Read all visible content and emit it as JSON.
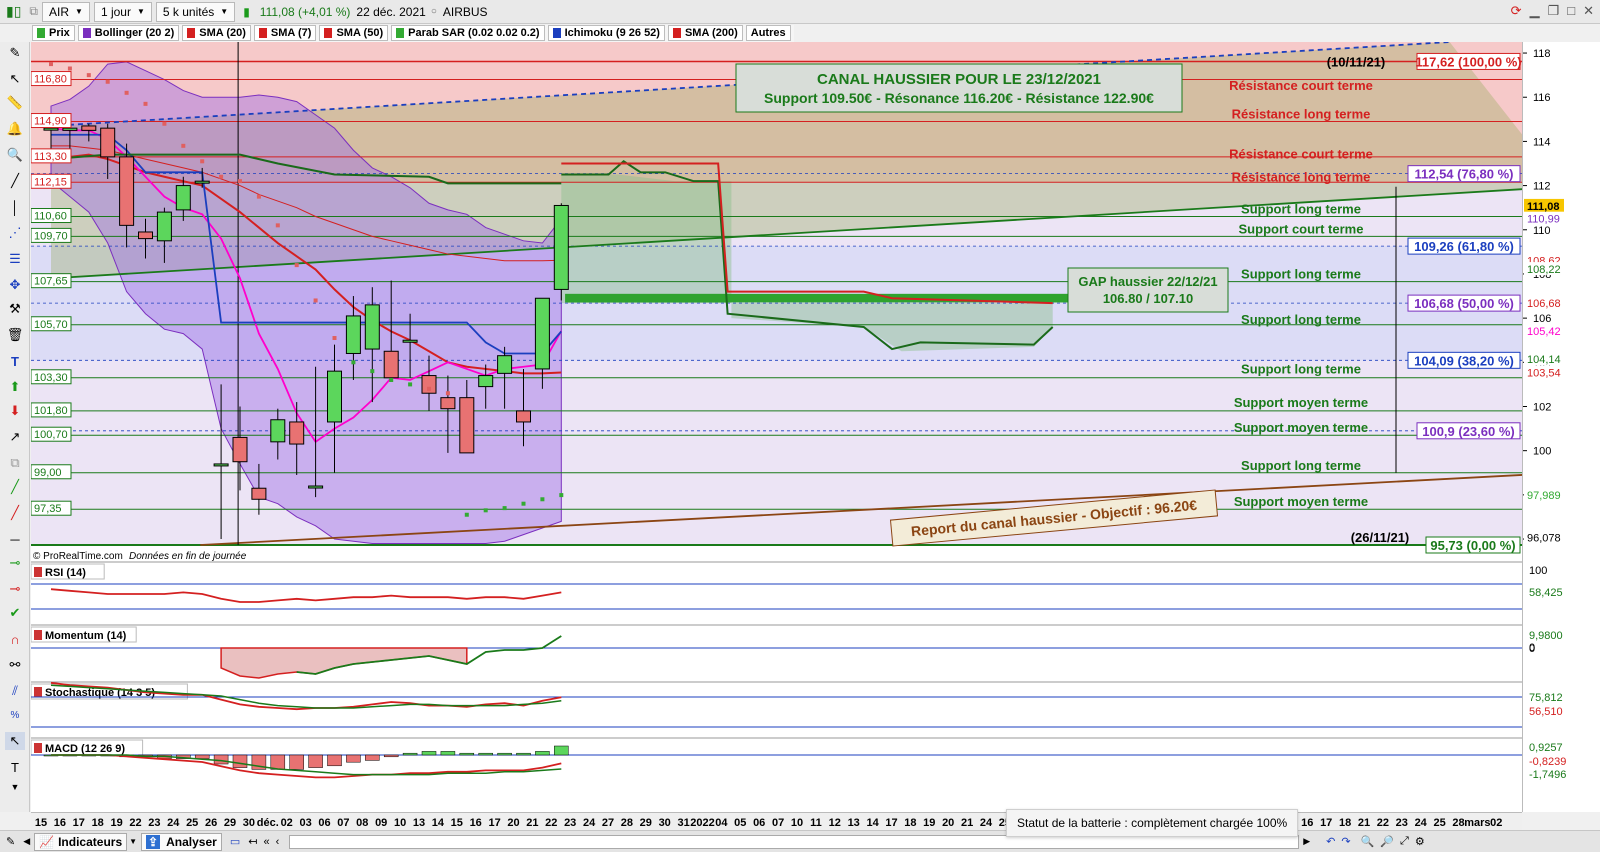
{
  "toolbar": {
    "ticker": "AIR",
    "period": "1 jour",
    "units": "5 k unités",
    "price": "111,08 (+4,01 %)",
    "date": "22 déc. 2021",
    "name": "AIRBUS"
  },
  "legend": [
    {
      "label": "Prix",
      "color": "#33aa33"
    },
    {
      "label": "Bollinger (20 2)",
      "color": "#7b2fbf"
    },
    {
      "label": "SMA (20)",
      "color": "#d42020"
    },
    {
      "label": "SMA (7)",
      "color": "#d42020"
    },
    {
      "label": "SMA (50)",
      "color": "#d42020"
    },
    {
      "label": "Parab SAR (0.02 0.02 0.2)",
      "color": "#33aa33"
    },
    {
      "label": "Ichimoku (9 26 52)",
      "color": "#1b3fbf"
    },
    {
      "label": "SMA (200)",
      "color": "#d42020"
    },
    {
      "label": "Autres",
      "color": ""
    }
  ],
  "annotations": {
    "canal_line1": "CANAL HAUSSIER POUR LE 23/12/2021",
    "canal_line2": "Support 109.50€ - Résonance 116.20€ - Résistance 122.90€",
    "gap_line1": "GAP haussier 22/12/21",
    "gap_line2": "106.80 / 107.10",
    "report": "Report du canal haussier - Objectif : 96.20€",
    "date_top": "(10/11/21)",
    "date_bottom": "(26/11/21)",
    "copyright": "© ProRealTime.com",
    "copyright_note": "Données en fin de journée"
  },
  "levels_left": [
    {
      "label": "116,80",
      "color": "#d42020"
    },
    {
      "label": "114,90",
      "color": "#d42020"
    },
    {
      "label": "113,30",
      "color": "#d42020"
    },
    {
      "label": "112,15",
      "color": "#d42020"
    },
    {
      "label": "110,60",
      "color": "#1a7a1a"
    },
    {
      "label": "109,70",
      "color": "#1a7a1a"
    },
    {
      "label": "107,65",
      "color": "#1a7a1a"
    },
    {
      "label": "105,70",
      "color": "#1a7a1a"
    },
    {
      "label": "103,30",
      "color": "#1a7a1a"
    },
    {
      "label": "101,80",
      "color": "#1a7a1a"
    },
    {
      "label": "100,70",
      "color": "#1a7a1a"
    },
    {
      "label": "99,00",
      "color": "#1a7a1a"
    },
    {
      "label": "97,35",
      "color": "#1a7a1a"
    }
  ],
  "level_texts": [
    {
      "label": "Résistance court terme",
      "color": "#d42020"
    },
    {
      "label": "Résistance long terme",
      "color": "#d42020"
    },
    {
      "label": "Résistance court terme",
      "color": "#d42020"
    },
    {
      "label": "Résistance long terme",
      "color": "#d42020"
    },
    {
      "label": "Support  long terme",
      "color": "#1a7a1a"
    },
    {
      "label": "Support court terme",
      "color": "#1a7a1a"
    },
    {
      "label": "Support  long terme",
      "color": "#1a7a1a"
    },
    {
      "label": "Support  long terme",
      "color": "#1a7a1a"
    },
    {
      "label": "Support  long terme",
      "color": "#1a7a1a"
    },
    {
      "label": "Support moyen terme",
      "color": "#1a7a1a"
    },
    {
      "label": "Support moyen terme",
      "color": "#1a7a1a"
    },
    {
      "label": "Support  long terme",
      "color": "#1a7a1a"
    },
    {
      "label": "Support moyen terme",
      "color": "#1a7a1a"
    }
  ],
  "fibo": [
    {
      "label": "117,62 (100,00 %)",
      "color": "#d42020"
    },
    {
      "label": "112,54 (76,80 %)",
      "color": "#7b2fbf"
    },
    {
      "label": "109,26 (61,80 %)",
      "color": "#1b3fbf"
    },
    {
      "label": "106,68 (50,00 %)",
      "color": "#7b2fbf"
    },
    {
      "label": "104,09 (38,20 %)",
      "color": "#1b3fbf"
    },
    {
      "label": "100,9 (23,60 %)",
      "color": "#7b2fbf"
    },
    {
      "label": "95,73 (0,00 %)",
      "color": "#1a7a1a"
    }
  ],
  "price_axis": [
    "118",
    "116",
    "114",
    "112",
    "110",
    "108",
    "106",
    "104",
    "102",
    "100",
    "98",
    "96"
  ],
  "right_tags": [
    {
      "label": "111,08",
      "color": "#000000",
      "bg": "#f7c600"
    },
    {
      "label": "110,99",
      "color": "#7b2fbf",
      "bg": "#ffffff"
    },
    {
      "label": "108,62",
      "color": "#d42020",
      "bg": "#ffffff"
    },
    {
      "label": "108,22",
      "color": "#1a7a1a",
      "bg": "#ffffff"
    },
    {
      "label": "106,68",
      "color": "#d42020",
      "bg": "#ffffff"
    },
    {
      "label": "105,42",
      "color": "#ff00cc",
      "bg": "#ffffff"
    },
    {
      "label": "104,14",
      "color": "#1a7a1a",
      "bg": "#ffffff"
    },
    {
      "label": "103,54",
      "color": "#d42020",
      "bg": "#ffffff"
    },
    {
      "label": "97,989",
      "color": "#33aa33",
      "bg": "#ffffff"
    },
    {
      "label": "96,078",
      "color": "#000000",
      "bg": "#ffffff"
    }
  ],
  "indicators": [
    {
      "label": "RSI (14)",
      "axis": [
        "100",
        "58,425",
        "0"
      ]
    },
    {
      "label": "Momentum (14)",
      "axis": [
        "9,9800",
        "0"
      ]
    },
    {
      "label": "Stochastique (14 3 5)",
      "axis": [
        "75,812",
        "56,510"
      ]
    },
    {
      "label": "MACD (12 26 9)",
      "axis": [
        "0,9257",
        "-0,8239",
        "-1,7496"
      ]
    }
  ],
  "dates": [
    "15",
    "16",
    "17",
    "18",
    "19",
    "22",
    "23",
    "24",
    "25",
    "26",
    "29",
    "30",
    "déc.",
    "02",
    "03",
    "06",
    "07",
    "08",
    "09",
    "10",
    "13",
    "14",
    "15",
    "16",
    "17",
    "20",
    "21",
    "22",
    "23",
    "24",
    "27",
    "28",
    "29",
    "30",
    "31",
    "2022",
    "04",
    "05",
    "06",
    "07",
    "10",
    "11",
    "12",
    "13",
    "14",
    "17",
    "18",
    "19",
    "20",
    "21",
    "24",
    "25",
    "26",
    "27",
    "28",
    "31",
    "févr.",
    "02",
    "03",
    "04",
    "07",
    "08",
    "09",
    "10",
    "11",
    "14",
    "15",
    "16",
    "17",
    "18",
    "21",
    "22",
    "23",
    "24",
    "25",
    "28",
    "mars",
    "02"
  ],
  "bottombar": {
    "indicators_label": "Indicateurs",
    "analyser_label": "Analyser",
    "battery": "Statut de la batterie : complètement chargée 100%"
  },
  "chart_data": {
    "type": "candlestick",
    "instrument": "AIRBUS",
    "x": [
      "15",
      "16",
      "17",
      "18",
      "19",
      "22",
      "23",
      "24",
      "25",
      "26",
      "29",
      "30",
      "déc.",
      "02",
      "03",
      "06",
      "07",
      "08",
      "09",
      "10",
      "13",
      "14",
      "15",
      "16",
      "17",
      "20",
      "21",
      "22"
    ],
    "open": [
      114.6,
      114.5,
      114.7,
      114.6,
      113.3,
      109.9,
      109.5,
      110.9,
      112.2,
      99.4,
      100.6,
      98.3,
      100.4,
      101.3,
      98.4,
      101.3,
      104.4,
      104.6,
      104.5,
      105.0,
      103.4,
      102.4,
      102.4,
      102.9,
      103.5,
      101.8,
      103.7,
      107.3
    ],
    "high": [
      115.0,
      114.9,
      114.8,
      114.8,
      113.9,
      110.5,
      111.0,
      112.4,
      112.8,
      103.0,
      102.0,
      99.4,
      101.9,
      102.2,
      103.8,
      104.8,
      107.0,
      107.4,
      107.7,
      106.2,
      104.3,
      103.4,
      103.2,
      103.9,
      104.7,
      103.7,
      105.8,
      111.2
    ],
    "low": [
      113.4,
      113.6,
      114.0,
      112.3,
      109.2,
      108.7,
      108.5,
      110.4,
      111.9,
      96.0,
      98.2,
      97.1,
      99.6,
      98.9,
      97.9,
      99.0,
      103.2,
      102.2,
      103.6,
      103.3,
      101.8,
      99.9,
      99.9,
      101.9,
      101.9,
      100.2,
      102.8,
      106.8
    ],
    "close": [
      114.6,
      114.6,
      114.5,
      113.3,
      110.2,
      109.6,
      110.8,
      112.0,
      112.2,
      99.4,
      99.5,
      97.8,
      101.4,
      100.3,
      98.4,
      103.6,
      106.1,
      106.6,
      103.3,
      105.0,
      102.6,
      101.9,
      99.9,
      103.4,
      104.3,
      101.3,
      106.9,
      111.1
    ],
    "ylim": [
      95.73,
      118.5
    ],
    "canal_low": [
      [
        0,
        107.8
      ],
      [
        80,
        111.95
      ]
    ],
    "canal_high": [
      [
        0,
        114.7
      ],
      [
        74,
        118.5
      ]
    ],
    "report_line": [
      [
        7.9,
        95.73
      ],
      [
        80,
        99.0
      ]
    ],
    "bollinger_upper": [
      115.6,
      115.9,
      116.5,
      117.5,
      117.6,
      117.2,
      116.8,
      116.3,
      116.0,
      116.0,
      116.0,
      116.1,
      116.0,
      115.8,
      115.2,
      114.6,
      113.6,
      112.8,
      112.4,
      111.9,
      111.2,
      110.9,
      110.7,
      110.1,
      109.8,
      109.5,
      109.4,
      110.5
    ],
    "bollinger_lower": [
      112.2,
      111.5,
      110.8,
      109.4,
      107.2,
      106.2,
      105.5,
      105.3,
      104.6,
      101.0,
      99.4,
      97.9,
      97.6,
      97.0,
      96.6,
      96.0,
      95.9,
      95.8,
      95.8,
      95.8,
      95.8,
      95.8,
      95.8,
      95.8,
      95.9,
      96.2,
      96.5,
      96.8
    ],
    "sma20": [
      113.2,
      113.3,
      113.4,
      113.2,
      112.9,
      112.6,
      112.4,
      112.2,
      112.0,
      111.4,
      110.8,
      110.1,
      109.4,
      108.8,
      108.2,
      107.3,
      106.5,
      105.9,
      105.4,
      105.0,
      104.5,
      104.0,
      103.8,
      103.7,
      103.6,
      103.5,
      103.5,
      103.54
    ],
    "sma7": [
      114.6,
      114.5,
      114.5,
      114.1,
      113.3,
      112.4,
      111.5,
      111.0,
      110.7,
      109.6,
      107.8,
      105.3,
      103.7,
      101.7,
      100.4,
      101.0,
      101.5,
      102.3,
      103.3,
      103.2,
      103.6,
      104.0,
      103.7,
      103.4,
      103.7,
      103.8,
      103.9,
      105.42
    ],
    "sma50": [
      113.8,
      113.8,
      113.7,
      113.6,
      113.4,
      113.2,
      113.0,
      112.8,
      112.6,
      112.3,
      112.0,
      111.6,
      111.3,
      111.0,
      110.6,
      110.3,
      110.0,
      109.7,
      109.5,
      109.3,
      109.1,
      108.9,
      108.8,
      108.7,
      108.6,
      108.6,
      108.6,
      108.62
    ],
    "ichimoku_tenkan": [
      114.3,
      114.3,
      114.3,
      114.3,
      113.6,
      112.6,
      112.6,
      112.6,
      112.6,
      105.8,
      105.8,
      105.8,
      105.8,
      105.8,
      105.8,
      105.8,
      105.8,
      105.8,
      105.8,
      105.8,
      105.8,
      105.8,
      105.8,
      104.9,
      104.4,
      104.4,
      104.4,
      105.4
    ],
    "psar": [
      117.5,
      117.3,
      117.0,
      116.7,
      116.2,
      115.7,
      114.8,
      113.8,
      113.1,
      112.4,
      112.2,
      111.5,
      110.2,
      108.4,
      106.8,
      105.1,
      104.0,
      103.6,
      103.2,
      103.0,
      102.8,
      102.6,
      97.1,
      97.3,
      97.4,
      97.6,
      97.8,
      97.989
    ],
    "fibonacci": {
      "100": 117.62,
      "76.8": 112.54,
      "61.8": 109.26,
      "50": 106.68,
      "38.2": 104.09,
      "23.6": 100.9,
      "0": 95.73
    },
    "levels": [
      116.8,
      114.9,
      113.3,
      112.15,
      110.6,
      109.7,
      107.65,
      105.7,
      103.3,
      101.8,
      100.7,
      99.0,
      97.35
    ],
    "gap": [
      106.8,
      107.1
    ],
    "rsi_last": 58.425,
    "momentum_last": 9.98,
    "stoch_k": 75.812,
    "stoch_d": 56.51,
    "macd": [
      0.9257,
      -0.8239,
      -1.7496
    ]
  }
}
